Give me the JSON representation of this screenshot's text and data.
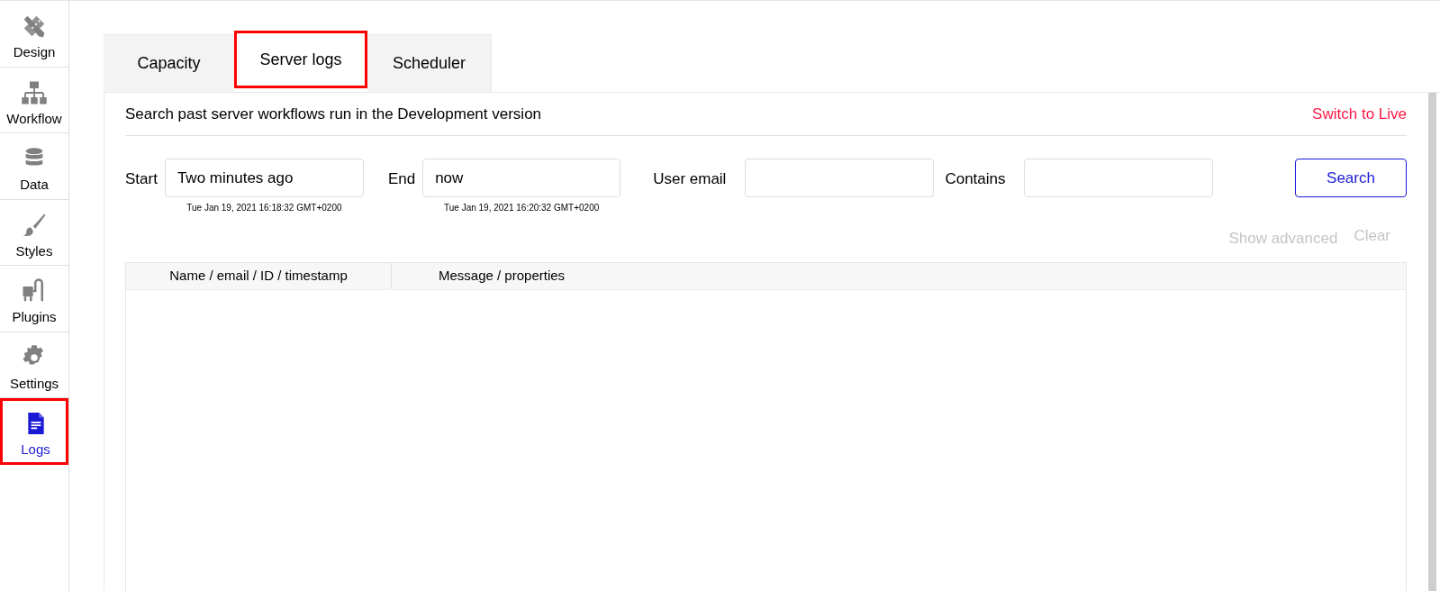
{
  "sidebar": {
    "items": [
      {
        "kind": "design",
        "label": "Design",
        "selected": false,
        "highlighted": false
      },
      {
        "kind": "workflow",
        "label": "Workflow",
        "selected": false,
        "highlighted": false
      },
      {
        "kind": "data",
        "label": "Data",
        "selected": false,
        "highlighted": false
      },
      {
        "kind": "styles",
        "label": "Styles",
        "selected": false,
        "highlighted": false
      },
      {
        "kind": "plugins",
        "label": "Plugins",
        "selected": false,
        "highlighted": false
      },
      {
        "kind": "settings",
        "label": "Settings",
        "selected": false,
        "highlighted": false
      },
      {
        "kind": "logs",
        "label": "Logs",
        "selected": true,
        "highlighted": true
      }
    ]
  },
  "tabs": [
    {
      "label": "Capacity",
      "selected": false,
      "highlighted": false
    },
    {
      "label": "Server logs",
      "selected": true,
      "highlighted": true
    },
    {
      "label": "Scheduler",
      "selected": false,
      "highlighted": false
    }
  ],
  "header": {
    "description": "Search past server workflows run in the Development version",
    "switch_link": "Switch to Live"
  },
  "filters": {
    "start": {
      "label": "Start",
      "value": "Two minutes ago",
      "hint": "Tue Jan 19, 2021 16:18:32 GMT+0200"
    },
    "end": {
      "label": "End",
      "value": "now",
      "hint": "Tue Jan 19, 2021 16:20:32 GMT+0200"
    },
    "user_email": {
      "label": "User email"
    },
    "contains": {
      "label": "Contains"
    },
    "search_button": "Search",
    "show_advanced": "Show advanced",
    "clear": "Clear"
  },
  "table": {
    "columns": [
      "Name / email / ID / timestamp",
      "Message / properties"
    ]
  }
}
